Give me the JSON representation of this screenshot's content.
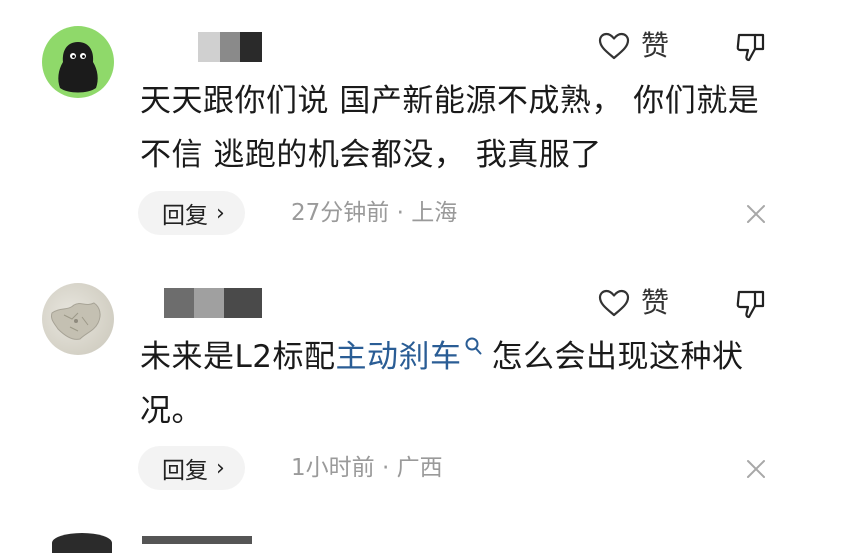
{
  "comments": [
    {
      "text": "天天跟你们说 国产新能源不成熟， 你们就是不信 逃跑的机会都没， 我真服了",
      "like_label": "赞",
      "reply_label": "回复",
      "reply_chevron": "›",
      "time": "27分钟前",
      "location": "上海",
      "avatar": "black-blob-character-icon",
      "avatar_color": "#8fd96a"
    },
    {
      "text_before_link": "未来是L2标配",
      "link_text": "主动刹车",
      "text_after_link": "怎么会出现这种状况。",
      "like_label": "赞",
      "reply_label": "回复",
      "reply_chevron": "›",
      "time": "1小时前",
      "location": "广西",
      "avatar": "map-icon",
      "link_color": "#2a5d95"
    }
  ],
  "meta_separator": " · ",
  "colors": {
    "text": "#1a1a1a",
    "meta": "#9a9a9a",
    "reply_bg": "#f3f3f3",
    "link": "#2a5d95"
  }
}
